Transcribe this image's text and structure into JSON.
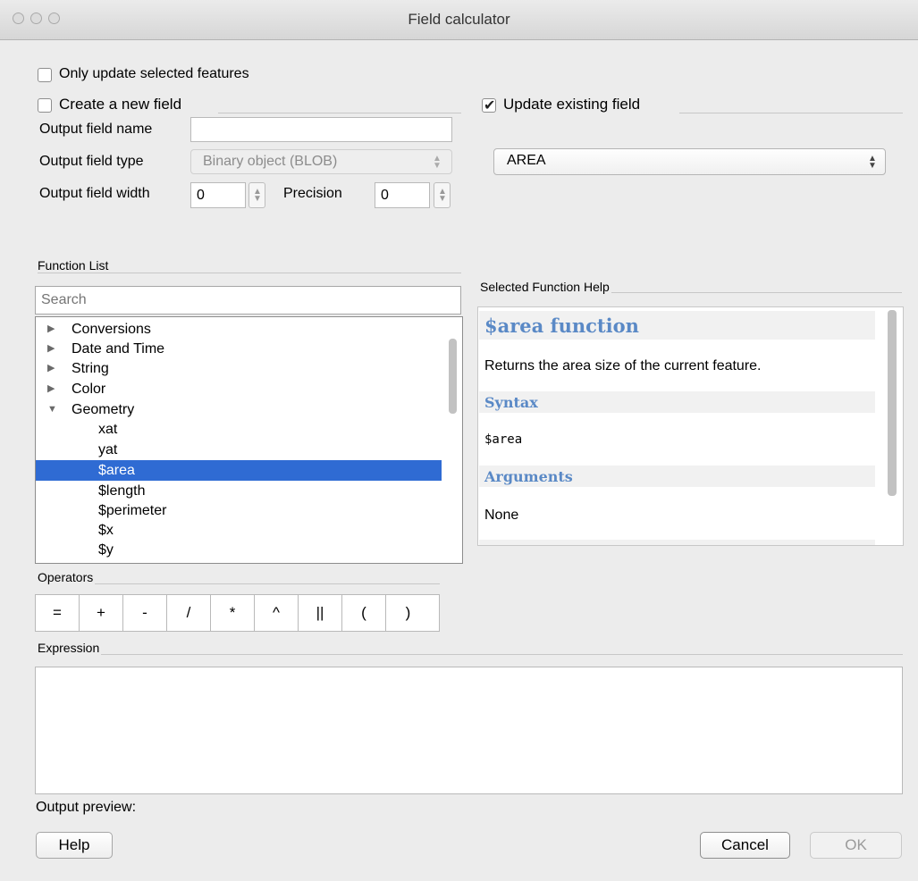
{
  "window": {
    "title": "Field calculator"
  },
  "only_selected": {
    "label": "Only update selected features",
    "checked": false
  },
  "create_field": {
    "label": "Create a new field",
    "checked": false,
    "name_label": "Output field name",
    "name_value": "",
    "type_label": "Output field type",
    "type_value": "Binary object (BLOB)",
    "width_label": "Output field width",
    "width_value": "0",
    "precision_label": "Precision",
    "precision_value": "0"
  },
  "update_field": {
    "label": "Update existing field",
    "checked": true,
    "selected": "AREA"
  },
  "function_list": {
    "heading": "Function List",
    "search_placeholder": "Search",
    "items": [
      {
        "label": "Conversions",
        "kind": "group",
        "expanded": false
      },
      {
        "label": "Date and Time",
        "kind": "group",
        "expanded": false
      },
      {
        "label": "String",
        "kind": "group",
        "expanded": false
      },
      {
        "label": "Color",
        "kind": "group",
        "expanded": false
      },
      {
        "label": "Geometry",
        "kind": "group",
        "expanded": true
      },
      {
        "label": "xat",
        "kind": "leaf"
      },
      {
        "label": "yat",
        "kind": "leaf"
      },
      {
        "label": "$area",
        "kind": "leaf",
        "selected": true
      },
      {
        "label": "$length",
        "kind": "leaf"
      },
      {
        "label": "$perimeter",
        "kind": "leaf"
      },
      {
        "label": "$x",
        "kind": "leaf"
      },
      {
        "label": "$y",
        "kind": "leaf"
      }
    ]
  },
  "help": {
    "heading": "Selected Function Help",
    "title": "$area function",
    "description": "Returns the area size of the current feature.",
    "syntax_heading": "Syntax",
    "syntax": "$area",
    "arguments_heading": "Arguments",
    "arguments": "None"
  },
  "operators": {
    "heading": "Operators",
    "items": [
      "=",
      "+",
      "-",
      "/",
      "*",
      "^",
      "||",
      "(",
      ")"
    ]
  },
  "expression": {
    "heading": "Expression",
    "value": "",
    "preview_label": "Output preview:"
  },
  "buttons": {
    "help": "Help",
    "cancel": "Cancel",
    "ok": "OK"
  }
}
